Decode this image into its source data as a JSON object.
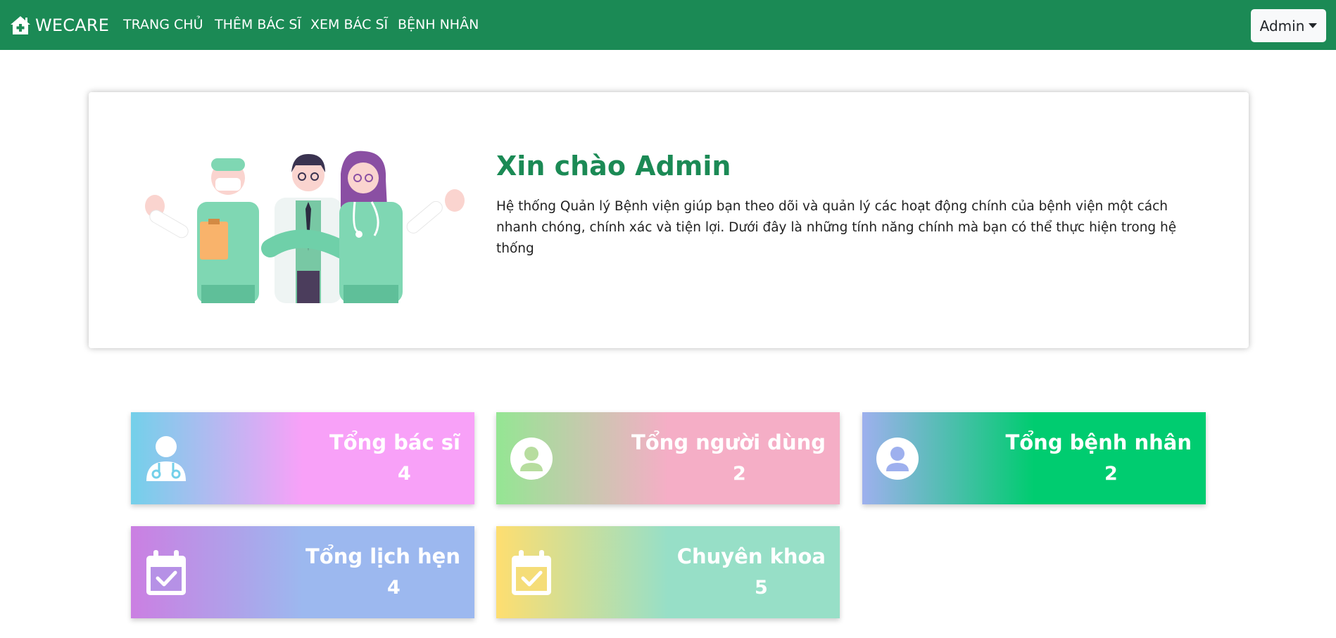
{
  "navbar": {
    "brand": "WECARE",
    "links": [
      "TRANG CHỦ",
      "THÊM BÁC SĨ",
      "XEM BÁC SĨ",
      "BỆNH NHÂN"
    ],
    "user_menu": "Admin",
    "background": "#1b8a55"
  },
  "welcome": {
    "title": "Xin chào Admin",
    "description": "Hệ thống Quản lý Bệnh viện giúp bạn theo dõi và quản lý các hoạt động chính của bệnh viện một cách nhanh chóng, chính xác và tiện lợi. Dưới đây là những tính năng chính mà bạn có thể thực hiện trong hệ thống"
  },
  "stats": [
    {
      "label": "Tổng bác sĩ",
      "value": "4",
      "icon": "doctor-icon",
      "colors": [
        "#73d0ea",
        "#f8a1f8"
      ]
    },
    {
      "label": "Tổng người dùng",
      "value": "2",
      "icon": "user-circle-icon",
      "colors": [
        "#94e693",
        "#f5aec6"
      ]
    },
    {
      "label": "Tổng bệnh nhân",
      "value": "2",
      "icon": "user-circle-icon",
      "colors": [
        "#9eb0ee",
        "#00cc70"
      ]
    },
    {
      "label": "Tổng lịch hẹn",
      "value": "4",
      "icon": "calendar-check-icon",
      "colors": [
        "#cb7fe2",
        "#9cb8ef"
      ]
    },
    {
      "label": "Chuyên khoa",
      "value": "5",
      "icon": "calendar-check-icon",
      "colors": [
        "#fede70",
        "#97dfc7"
      ]
    }
  ]
}
